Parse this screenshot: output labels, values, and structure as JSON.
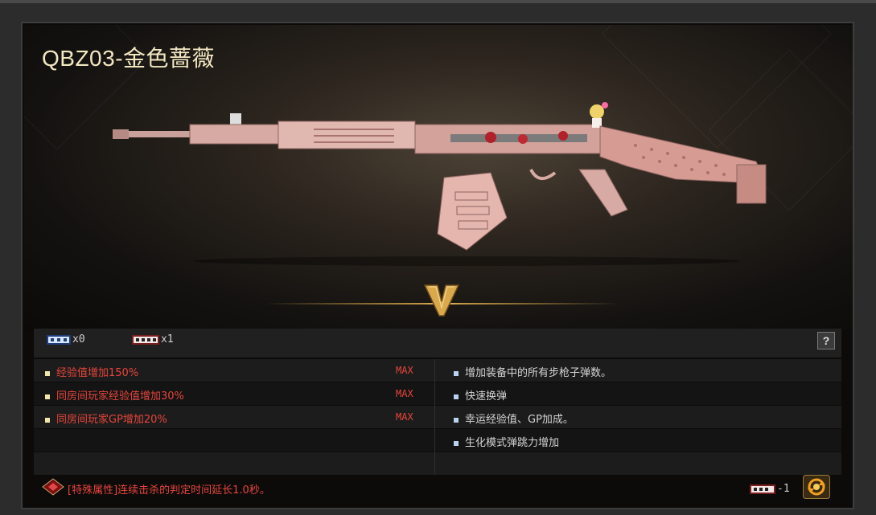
{
  "weapon": {
    "title": "QBZ03-金色蔷薇",
    "rank": "V"
  },
  "counts": [
    {
      "icon": "blue-coupon-icon",
      "text": "x0"
    },
    {
      "icon": "red-coupon-icon",
      "text": "x1"
    }
  ],
  "help_label": "?",
  "left_attributes": [
    {
      "text": "经验值增加150%",
      "max": "MAX"
    },
    {
      "text": "同房间玩家经验值增加30%",
      "max": "MAX"
    },
    {
      "text": "同房间玩家GP增加20%",
      "max": "MAX"
    }
  ],
  "right_attributes": [
    "增加装备中的所有步枪子弹数。",
    "快速换弹",
    "幸运经验值、GP加成。",
    "生化模式弹跳力增加"
  ],
  "special": "[特殊属性]连续击杀的判定时间延长1.0秒。",
  "cost": "-1",
  "colors": {
    "accent_red": "#e6453b",
    "title_gold": "#f3e7c2",
    "rank_gold": "#d9a94c"
  }
}
